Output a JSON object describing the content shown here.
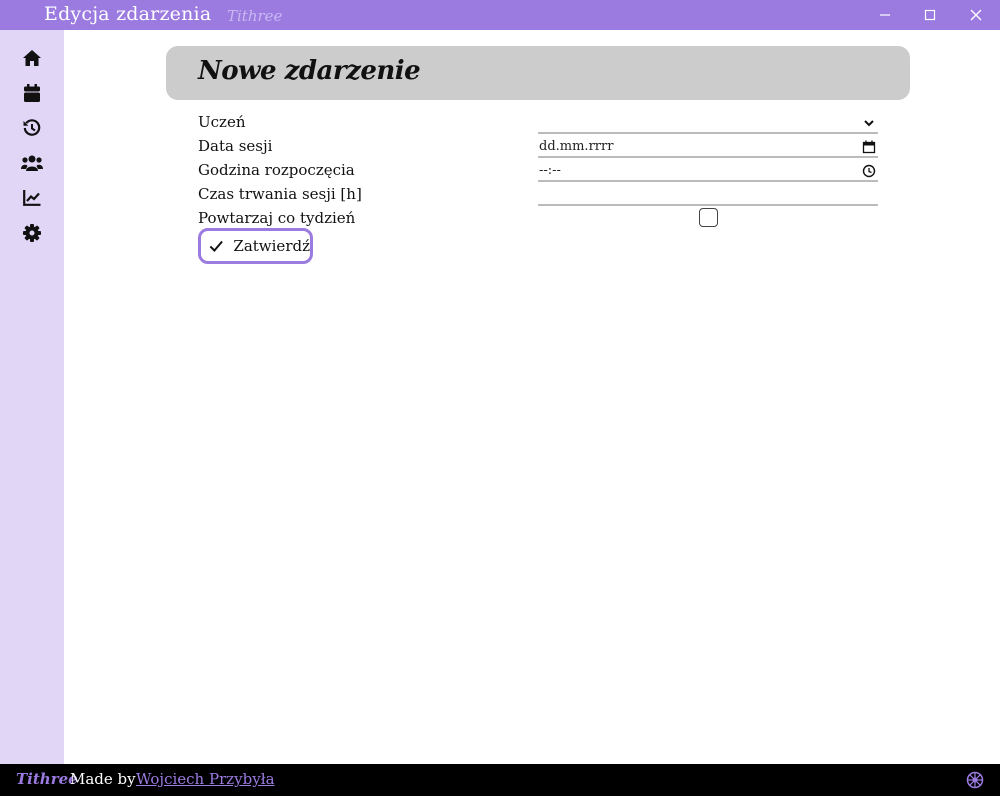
{
  "window": {
    "title": "Edycja zdarzenia",
    "brand": "Tithree",
    "controls": [
      "minimize-icon",
      "maximize-icon",
      "close-icon"
    ]
  },
  "sidebar": {
    "items": [
      {
        "name": "home",
        "icon": "home-icon"
      },
      {
        "name": "calendar",
        "icon": "calendar-icon"
      },
      {
        "name": "history",
        "icon": "history-icon"
      },
      {
        "name": "students",
        "icon": "users-icon"
      },
      {
        "name": "stats",
        "icon": "chart-line-icon"
      },
      {
        "name": "settings",
        "icon": "gear-icon"
      }
    ]
  },
  "page": {
    "title": "Nowe zdarzenie"
  },
  "form": {
    "student_label": "Uczeń",
    "student_value": "",
    "date_label": "Data sesji",
    "date_value": "dd.mm.rrrr",
    "time_label": "Godzina rozpoczęcia",
    "time_value": "--:--",
    "duration_label": "Czas trwania sesji [h]",
    "duration_value": "",
    "repeat_label": "Powtarzaj co tydzień",
    "repeat_checked": false,
    "submit_label": "Zatwierdź"
  },
  "footer": {
    "brand": "Tithree",
    "made_by": "Made by",
    "author": "Wojciech Przybyła"
  },
  "colors": {
    "accent": "#9b7be0",
    "sidebar_bg": "#e2d6f7",
    "header_bg": "#cccccc",
    "footer_bg": "#000000"
  }
}
